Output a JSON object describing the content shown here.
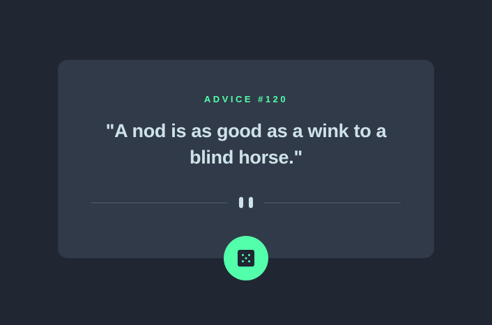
{
  "advice": {
    "label": "ADVICE #120",
    "quote": "\"A nod is as good as a wink to a blind horse.\""
  },
  "icons": {
    "divider": "pause-icon",
    "button": "dice-icon"
  },
  "colors": {
    "background": "#202632",
    "card": "#313a48",
    "accent": "#53ffaa",
    "text": "#cee3e9",
    "divider": "#4f5d74"
  }
}
